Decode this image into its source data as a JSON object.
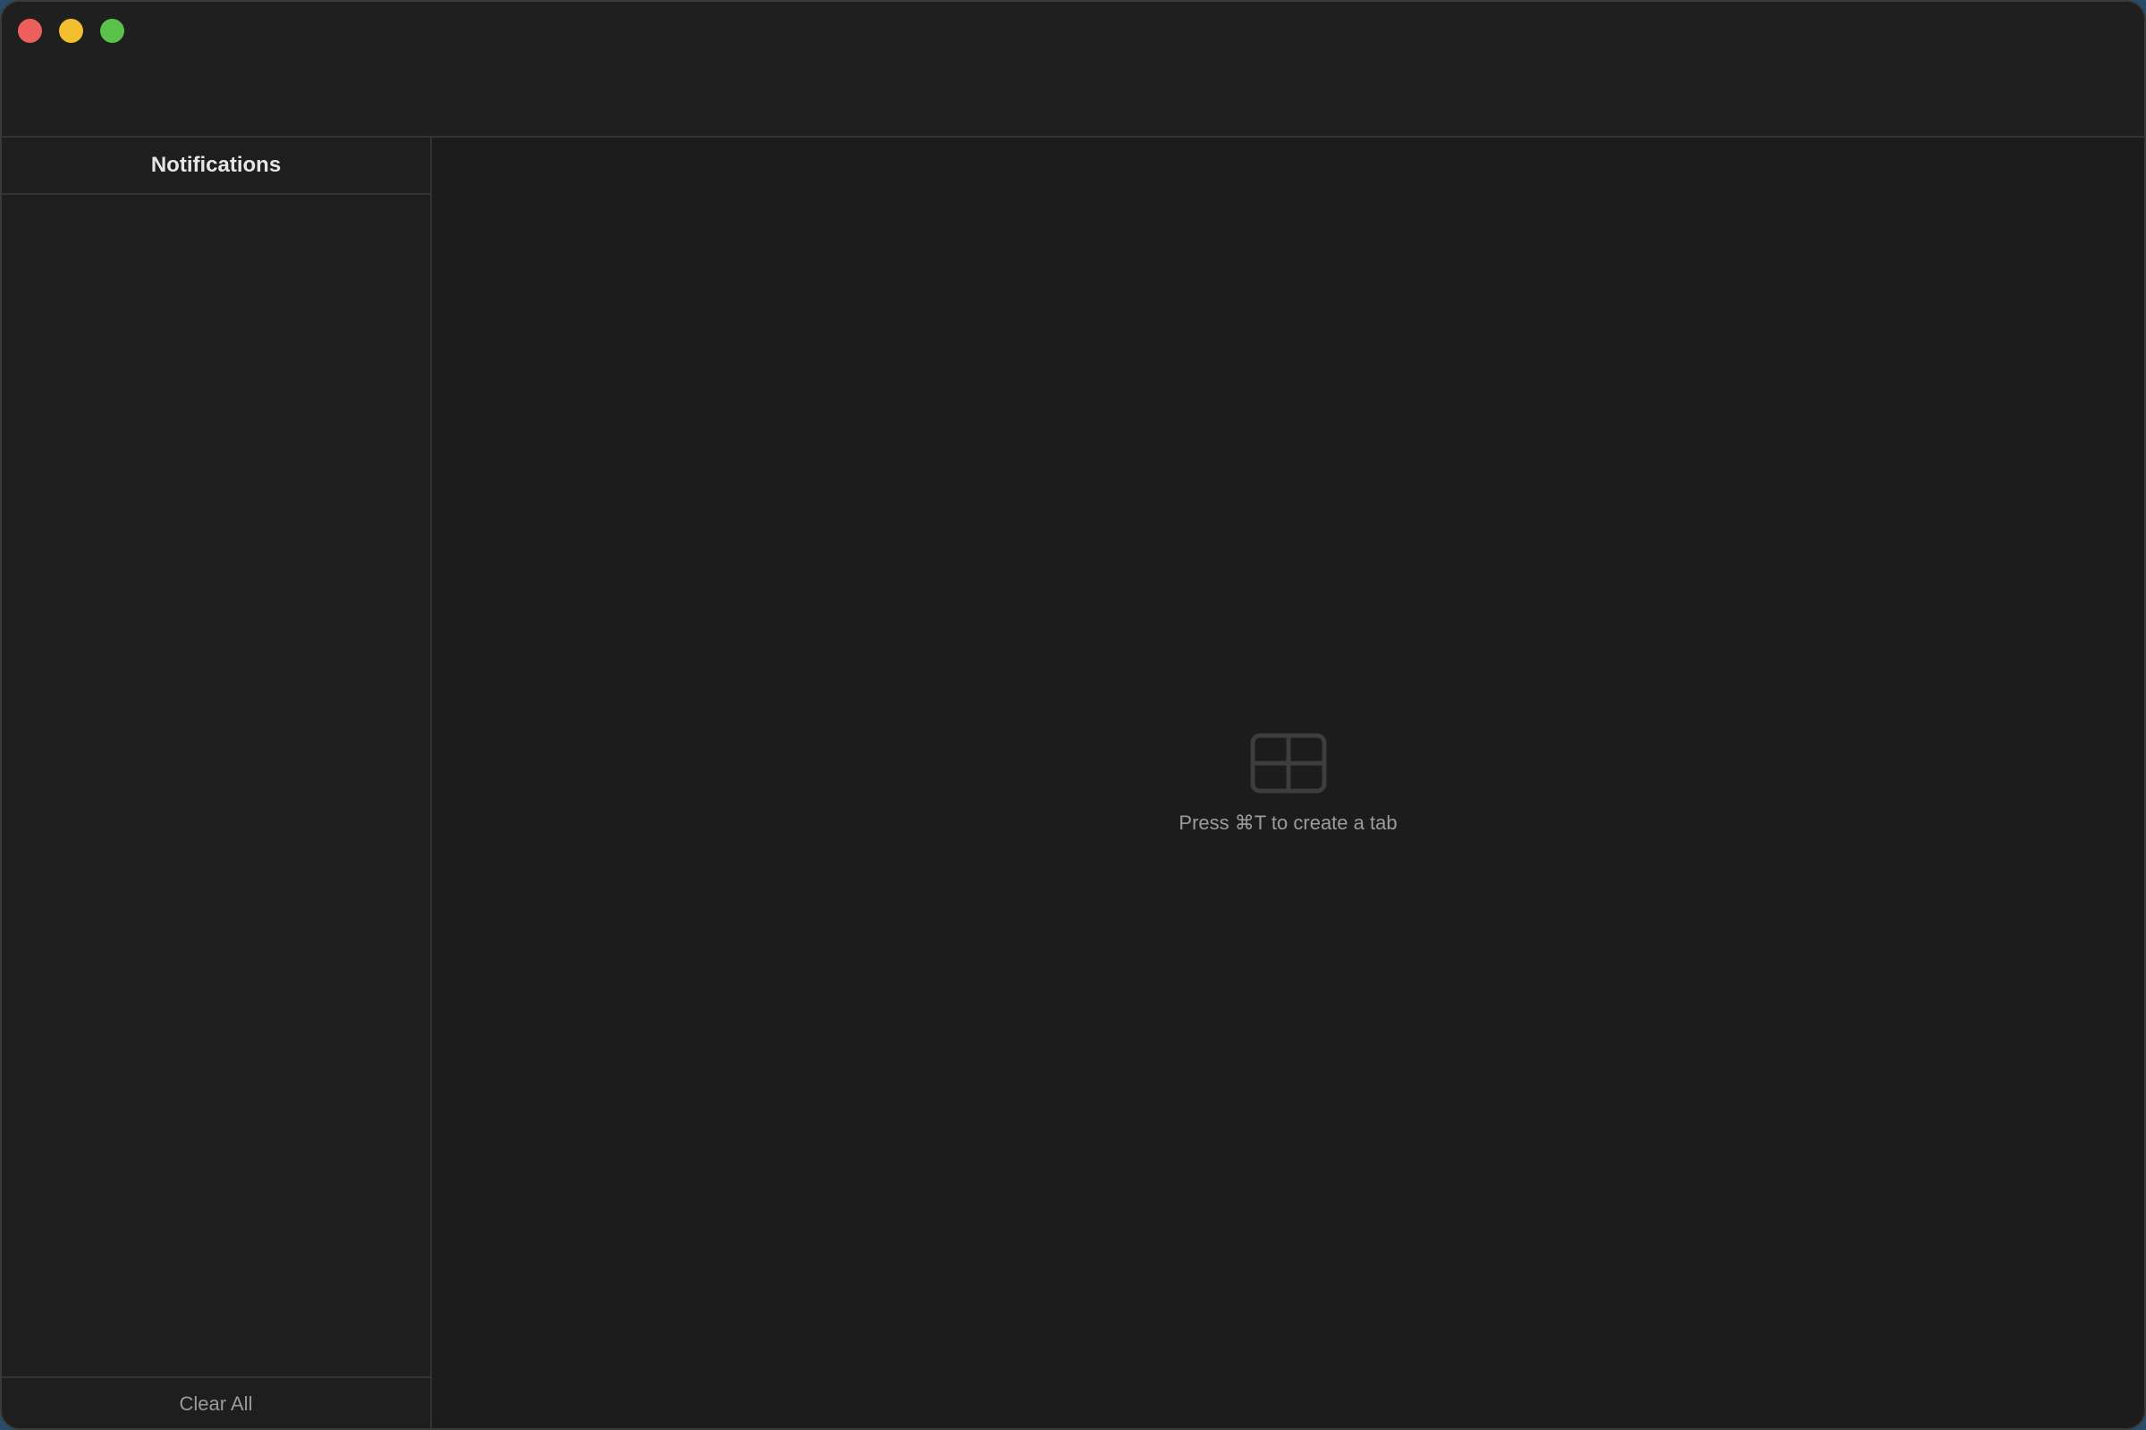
{
  "window": {
    "controls": [
      {
        "name": "close",
        "color": "#ec5f5a"
      },
      {
        "name": "minimize",
        "color": "#f4bf2f"
      },
      {
        "name": "zoom",
        "color": "#5ac24a"
      }
    ]
  },
  "sidebar": {
    "title": "Notifications",
    "notifications": [],
    "clear_all_label": "Clear All"
  },
  "main": {
    "empty_state": {
      "icon": "grid-layout-icon",
      "text": "Press ⌘T to create a tab"
    }
  }
}
